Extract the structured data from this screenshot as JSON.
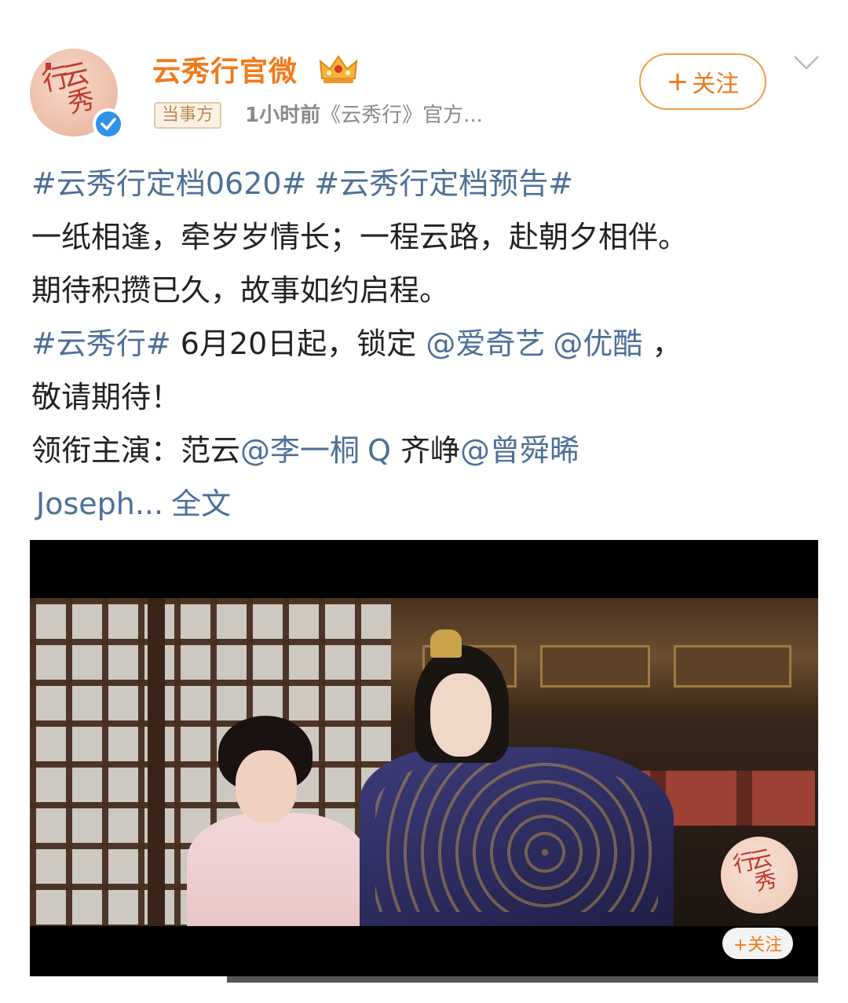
{
  "post": {
    "author": {
      "name": "云秀行官微",
      "avatar_text": "云秀行",
      "verified": true
    },
    "badge": "当事方",
    "time": "1小时前",
    "source": "《云秀行》官方...",
    "follow_label": "关注",
    "follow_plus": "+",
    "text": {
      "line1": {
        "tag1": "#云秀行定档0620#",
        "tag2": "#云秀行定档预告#"
      },
      "line2": "一纸相逢，牵岁岁情长；一程云路，赴朝夕相伴。",
      "line3": "期待积攒已久，故事如约启程。",
      "line4": {
        "tag": "#云秀行#",
        "mid": " 6月20日起，锁定 ",
        "mention1": "@爱奇艺",
        "mention2": "@优酷",
        "end": " ，"
      },
      "line5": "敬请期待！",
      "line6": {
        "prefix": "领衔主演：范云",
        "mention1": "@李一桐",
        "q": "Q",
        "mid": " 齐峥",
        "mention2": "@曾舜晞"
      },
      "line7": {
        "name": "Joseph...",
        "more": "全文"
      }
    },
    "video": {
      "watermark_text": "云秀行",
      "follow_label": "+关注",
      "progress": 0.25
    }
  },
  "colors": {
    "accent": "#f27a1a",
    "link": "#4d6f98",
    "verified": "#2f92e8"
  },
  "icons": [
    "crown-icon",
    "verified-icon",
    "chevron-down-icon",
    "plus-icon"
  ]
}
